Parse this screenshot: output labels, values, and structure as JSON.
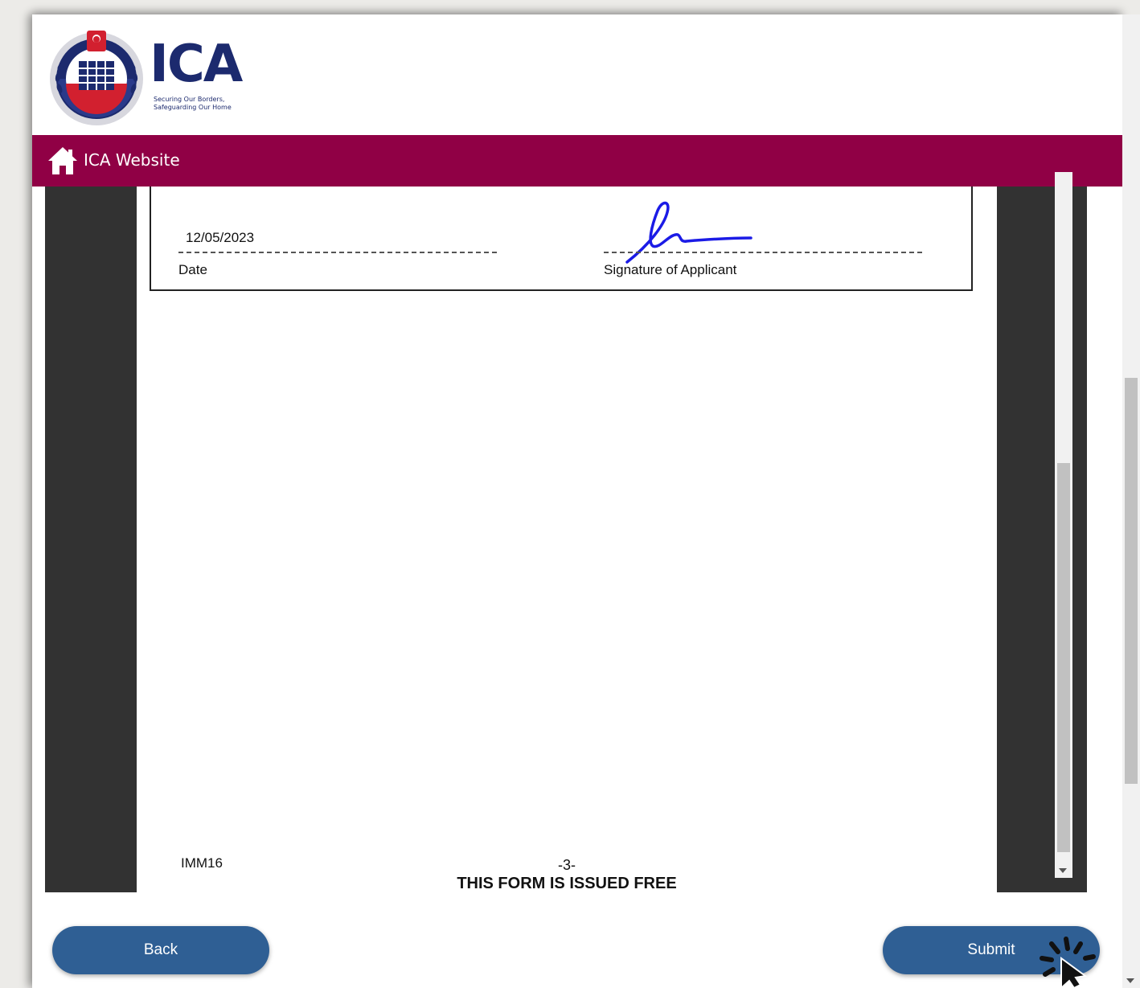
{
  "header": {
    "logo_text": "ICA",
    "tagline_line1": "Securing Our Borders,",
    "tagline_line2": "Safeguarding Our Home"
  },
  "nav": {
    "home_link_label": "ICA Website"
  },
  "document": {
    "date_value": "12/05/2023",
    "date_label": "Date",
    "signature_label": "Signature of Applicant",
    "form_code": "IMM16",
    "page_number": "-3-",
    "footer_notice": "THIS FORM IS ISSUED FREE"
  },
  "buttons": {
    "back_label": "Back",
    "submit_label": "Submit"
  },
  "colors": {
    "brand_navy": "#1c2a6e",
    "nav_bar": "#900045",
    "button": "#2f5f94",
    "signature_ink": "#1b1be6"
  },
  "icons": {
    "home": "home-icon",
    "cursor": "click-cursor-icon"
  }
}
